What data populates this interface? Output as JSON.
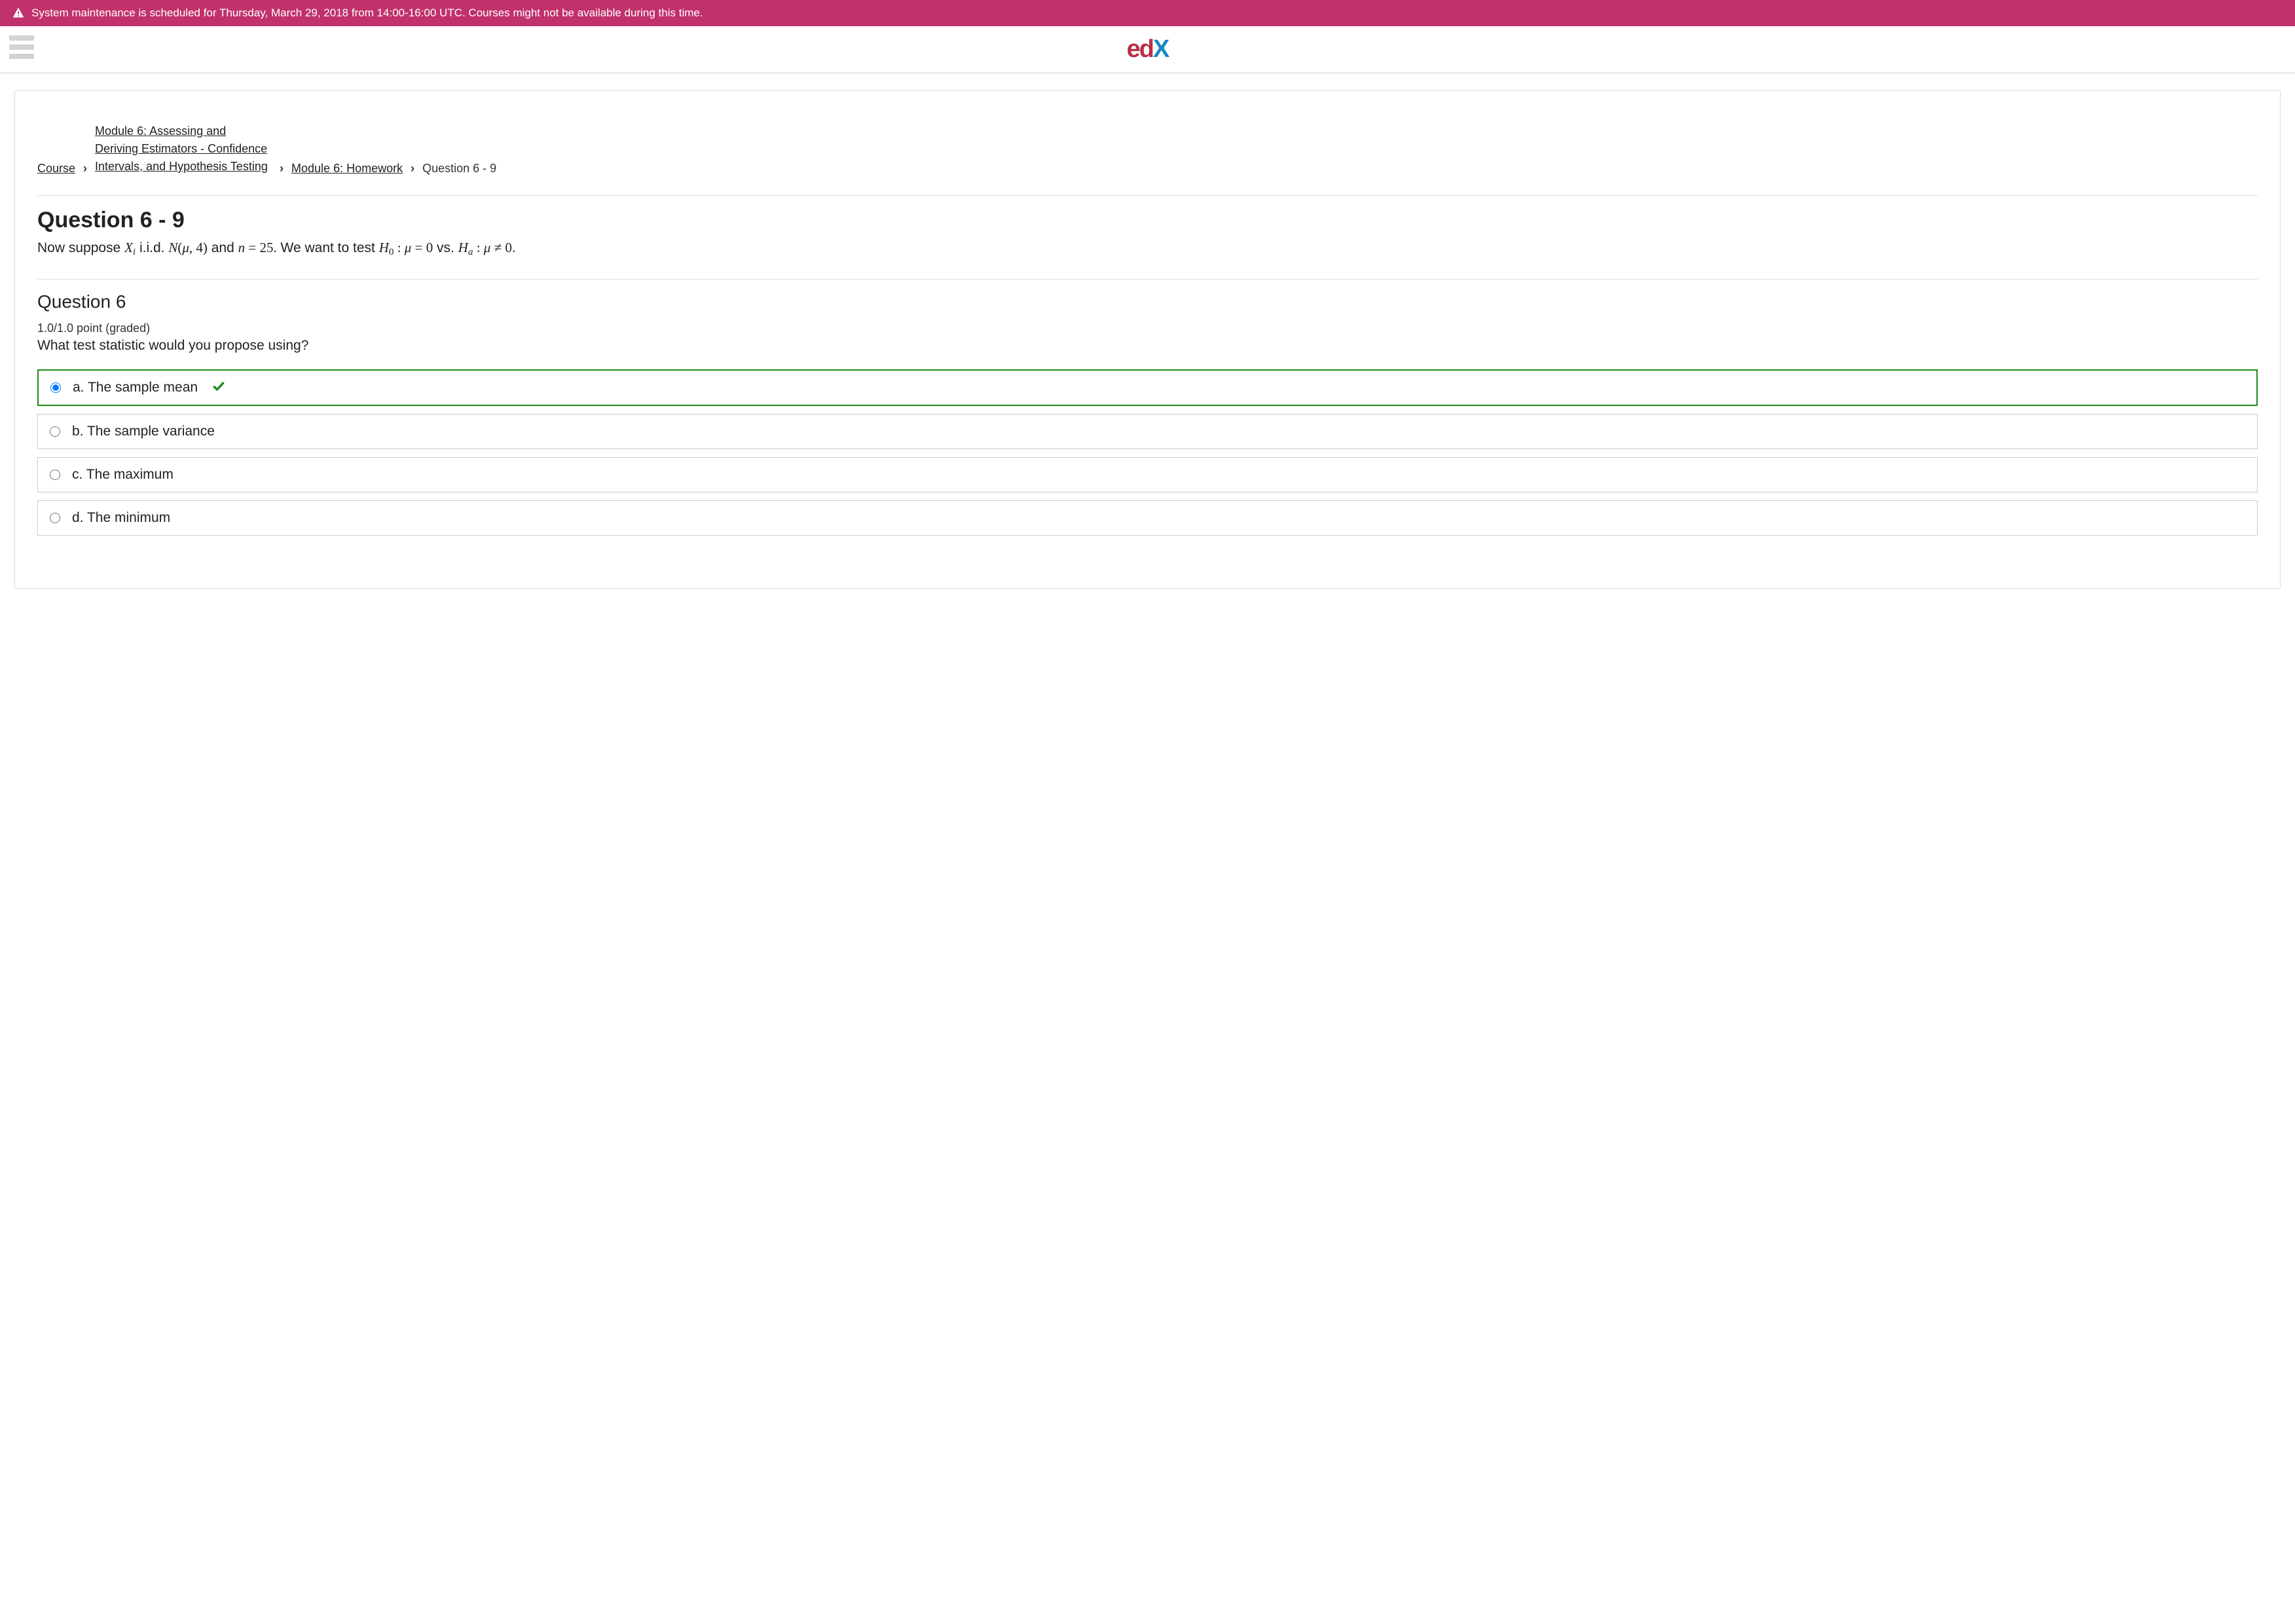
{
  "banner": {
    "text": "System maintenance is scheduled for Thursday, March 29, 2018 from 14:00-16:00 UTC. Courses might not be available during this time."
  },
  "logo": {
    "e": "e",
    "d": "d",
    "x": "X"
  },
  "breadcrumb": {
    "course": "Course",
    "module": "Module 6: Assessing and Deriving Estimators - Confidence Intervals, and Hypothesis Testing",
    "homework": "Module 6: Homework",
    "current": "Question 6 - 9",
    "sep": "›"
  },
  "section": {
    "title": "Question 6 - 9",
    "intro_prefix": "Now suppose ",
    "intro_mid1": " i.i.d. ",
    "intro_mid2": " and ",
    "intro_mid3": "  We want to test ",
    "intro_vs": " vs. ",
    "intro_end": "."
  },
  "q6": {
    "title": "Question 6",
    "grading": "1.0/1.0 point (graded)",
    "prompt": "What test statistic would you propose using?",
    "choices": [
      {
        "label": "a. The sample mean",
        "selected": true,
        "correct": true
      },
      {
        "label": "b. The sample variance",
        "selected": false,
        "correct": false
      },
      {
        "label": "c. The maximum",
        "selected": false,
        "correct": false
      },
      {
        "label": "d. The minimum",
        "selected": false,
        "correct": false
      }
    ]
  }
}
